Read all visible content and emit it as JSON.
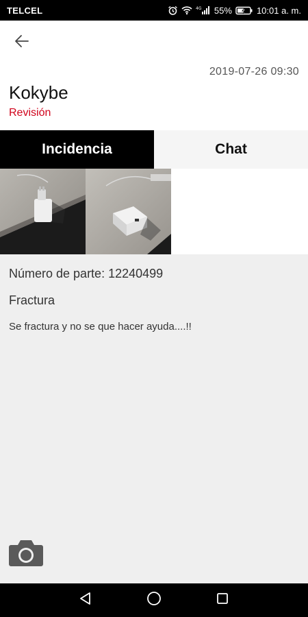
{
  "status_bar": {
    "carrier": "TELCEL",
    "network": "4G",
    "battery": "55%",
    "time": "10:01 a. m."
  },
  "header": {
    "timestamp": "2019-07-26 09:30",
    "user_name": "Kokybe",
    "status": "Revisión",
    "status_color": "#d0021b"
  },
  "tabs": [
    {
      "label": "Incidencia",
      "active": true
    },
    {
      "label": "Chat",
      "active": false
    }
  ],
  "photos": [
    {
      "name": "charger-photo-1"
    },
    {
      "name": "charger-photo-2"
    }
  ],
  "details": {
    "part_number": "Número de parte: 12240499",
    "category": "Fractura",
    "description": "Se fractura y no se que hacer ayuda....!!"
  },
  "icons": {
    "back": "arrow-left-icon",
    "camera": "camera-icon",
    "nav_back": "triangle-back-icon",
    "nav_home": "circle-home-icon",
    "nav_recents": "square-recents-icon"
  }
}
